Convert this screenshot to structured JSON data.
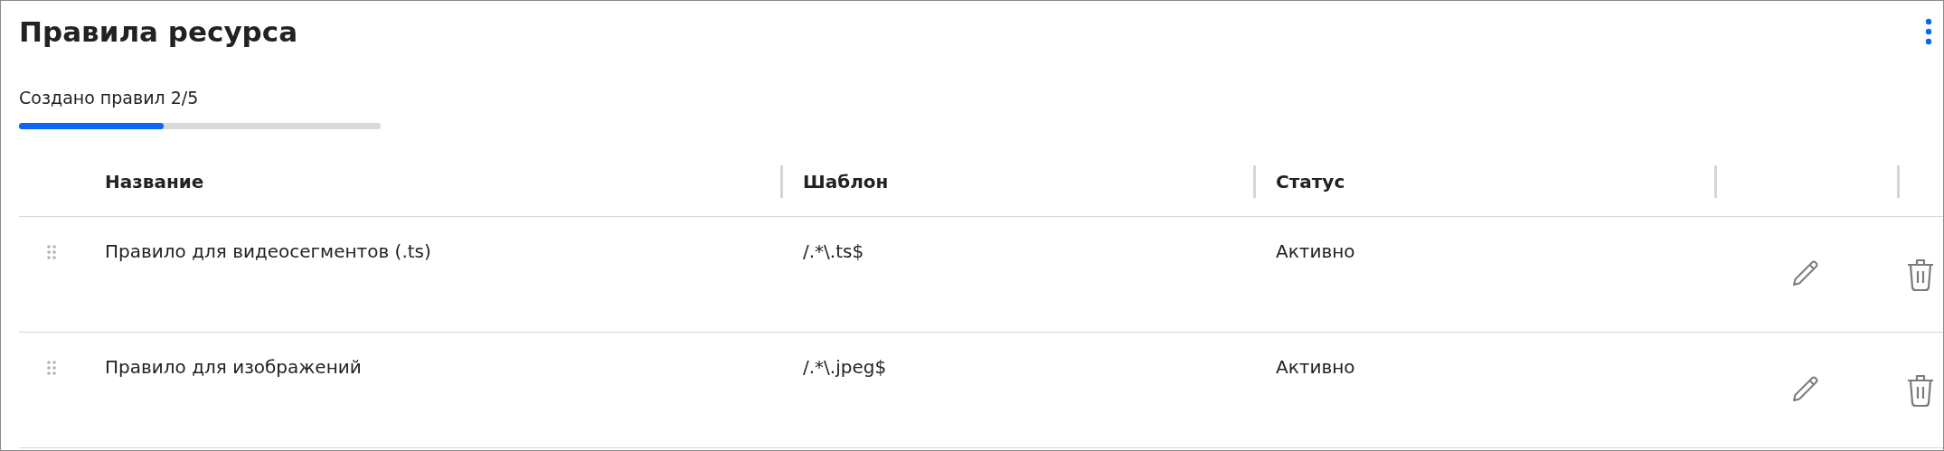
{
  "title": "Правила ресурса",
  "progress": {
    "label": "Создано правил 2/5",
    "level": 0.4
  },
  "table": {
    "columns": [
      "Название",
      "Шаблон",
      "Статус"
    ],
    "rows": [
      {
        "name": "Правило для видеосегментов (.ts)",
        "pattern": "/.*\\.ts$",
        "status": "Активно"
      },
      {
        "name": "Правило для изображений",
        "pattern": "/.*\\.jpeg$",
        "status": "Активно"
      }
    ]
  }
}
